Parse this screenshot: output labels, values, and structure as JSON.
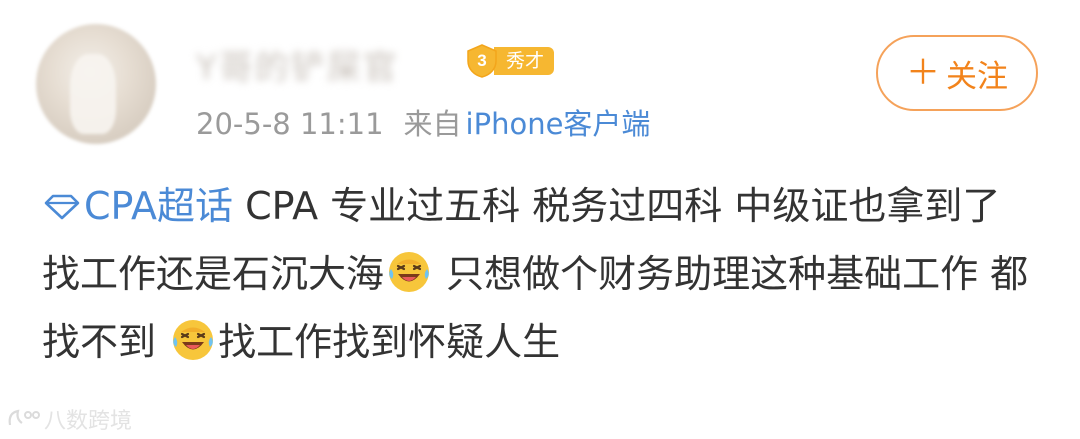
{
  "post": {
    "username": "Y哥的铲屎官",
    "level": {
      "number": "3",
      "label": "秀才"
    },
    "time": "20-5-8 11:11",
    "from_label": "来自",
    "client": "iPhone客户端",
    "follow_button": {
      "plus": "＋",
      "label": "关注"
    },
    "topic": "CPA超话",
    "content_parts": {
      "part1": "  CPA 专业过五科 税务过四科 中级证也拿到了 找工作还是石沉大海",
      "part2": " 只想做个财务助理这种基础工作 都找不到 ",
      "part3": "找工作找到怀疑人生"
    },
    "emoji_name": "laugh-cry-emoji"
  },
  "watermark": {
    "text": "八数跨境"
  },
  "colors": {
    "link_blue": "#4b8ad6",
    "follow_orange": "#f2831b",
    "badge_gold": "#f6b731",
    "meta_gray": "#9a9a9a",
    "text_dark": "#333333"
  }
}
